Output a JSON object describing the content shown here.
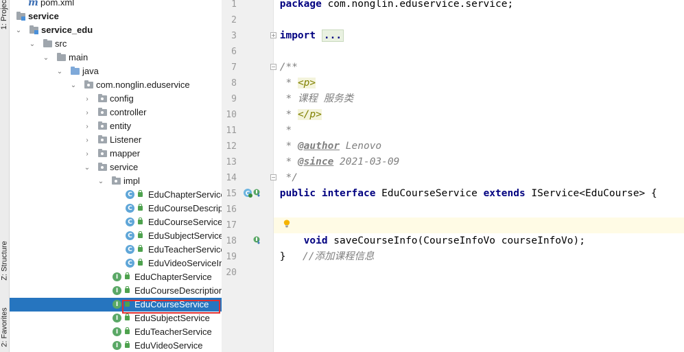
{
  "toolstrip": {
    "project_tab": "1: Project",
    "structure_tab": "Z: Structure",
    "favorites_tab": "2: Favorites"
  },
  "tree": {
    "items": [
      {
        "label": "pom.xml"
      },
      {
        "label": "service"
      },
      {
        "label": "service_edu"
      },
      {
        "label": "src"
      },
      {
        "label": "main"
      },
      {
        "label": "java"
      },
      {
        "label": "com.nonglin.eduservice"
      },
      {
        "label": "config"
      },
      {
        "label": "controller"
      },
      {
        "label": "entity"
      },
      {
        "label": "Listener"
      },
      {
        "label": "mapper"
      },
      {
        "label": "service"
      },
      {
        "label": "impl"
      },
      {
        "label": "EduChapterService"
      },
      {
        "label": "EduCourseDescrip"
      },
      {
        "label": "EduCourseServiceI"
      },
      {
        "label": "EduSubjectServiceI"
      },
      {
        "label": "EduTeacherService"
      },
      {
        "label": "EduVideoServiceIn"
      },
      {
        "label": "EduChapterService"
      },
      {
        "label": "EduCourseDescription"
      },
      {
        "label": "EduCourseService"
      },
      {
        "label": "EduSubjectService"
      },
      {
        "label": "EduTeacherService"
      },
      {
        "label": "EduVideoService"
      }
    ]
  },
  "editor": {
    "line_numbers": [
      "1",
      "2",
      "3",
      "6",
      "7",
      "8",
      "9",
      "10",
      "11",
      "12",
      "13",
      "14",
      "15",
      "16",
      "17",
      "18",
      "19",
      "20"
    ],
    "code": {
      "l1_kw": "package",
      "l1_rest": " com.nonglin.eduservice.service;",
      "l3_kw": "import",
      "l3_fold": "...",
      "l7": "/**",
      "l8_pre": " * ",
      "l8_tag": "<p>",
      "l9": " * 课程 服务类",
      "l10_pre": " * ",
      "l10_tag": "</p>",
      "l11": " *",
      "l12_pre": " * ",
      "l12_tag": "@author",
      "l12_val": " Lenovo",
      "l13_pre": " * ",
      "l13_tag": "@since",
      "l13_val": " 2021-03-09",
      "l14": " */",
      "l15_kw1": "public",
      "l15_kw2": "interface",
      "l15_name": " EduCourseService ",
      "l15_kw3": "extends",
      "l15_rest": " IService<EduCourse> {",
      "l17_comment": "//添加课程信息",
      "l18_kw": "void",
      "l18_rest": " saveCourseInfo(CourseInfoVo courseInfoVo);",
      "l19": "}"
    }
  }
}
